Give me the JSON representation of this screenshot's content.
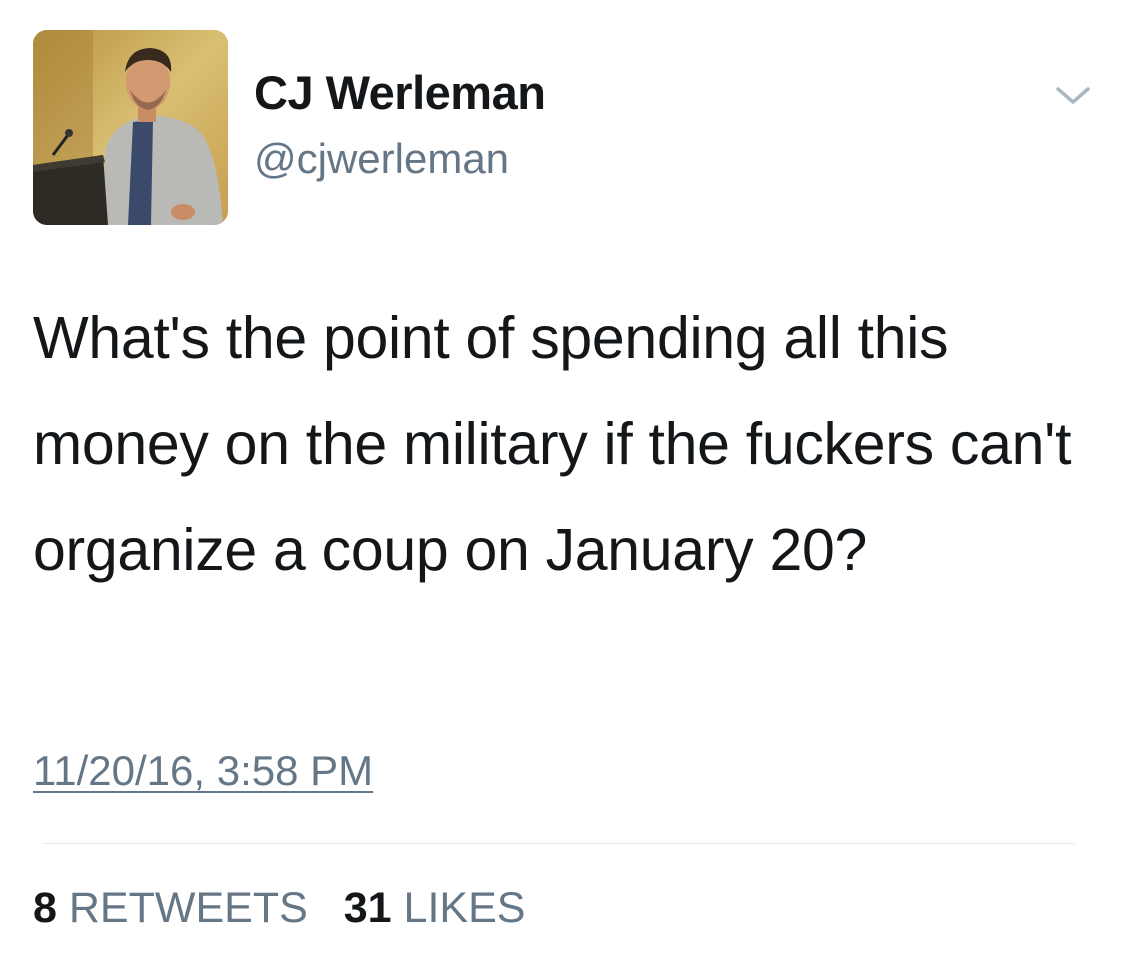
{
  "user": {
    "display_name": "CJ Werleman",
    "handle": "@cjwerleman",
    "avatar_icon": "profile-photo"
  },
  "tweet": {
    "text": "What's the point of spending all this money on the military if the fuckers can't organize a coup on January 20?",
    "timestamp": "11/20/16, 3:58 PM"
  },
  "stats": {
    "retweets_count": "8",
    "retweets_label": "RETWEETS",
    "likes_count": "31",
    "likes_label": "LIKES"
  },
  "icons": {
    "menu": "chevron-down-icon"
  },
  "colors": {
    "text_primary": "#14171a",
    "text_secondary": "#657786",
    "divider": "#e1e8ed",
    "chevron": "#aab8c2"
  }
}
